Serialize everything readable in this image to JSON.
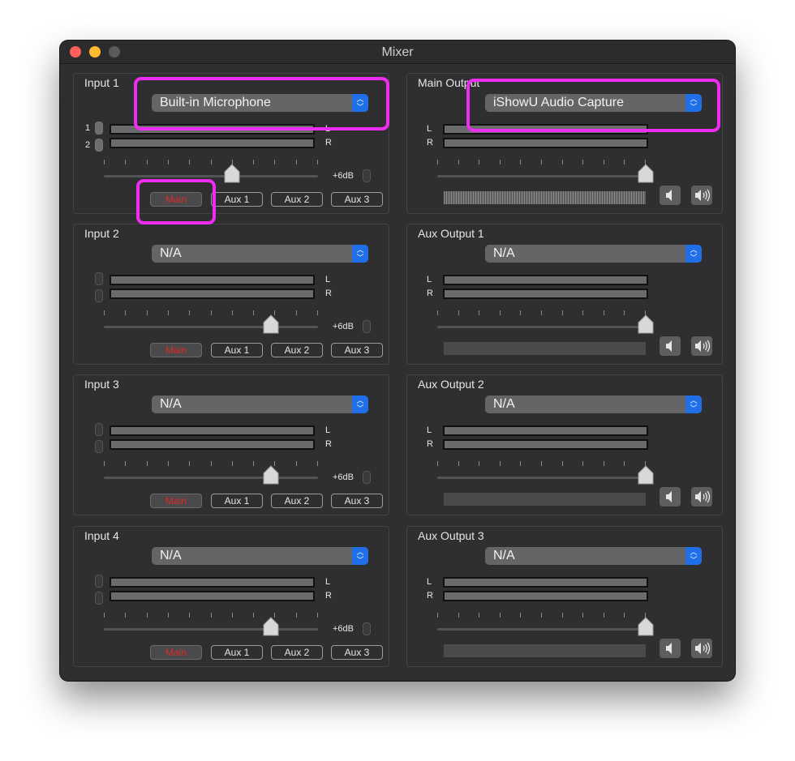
{
  "window": {
    "title": "Mixer"
  },
  "inputs": [
    {
      "title": "Input 1",
      "device": "Built-in Microphone",
      "channels": [
        "1",
        "2"
      ],
      "gain": "+6dB",
      "main_active": true,
      "buses": {
        "main": "Main",
        "aux1": "Aux 1",
        "aux2": "Aux 2",
        "aux3": "Aux 3"
      }
    },
    {
      "title": "Input 2",
      "device": "N/A",
      "gain": "+6dB",
      "buses": {
        "main": "Main",
        "aux1": "Aux 1",
        "aux2": "Aux 2",
        "aux3": "Aux 3"
      }
    },
    {
      "title": "Input 3",
      "device": "N/A",
      "gain": "+6dB",
      "buses": {
        "main": "Main",
        "aux1": "Aux 1",
        "aux2": "Aux 2",
        "aux3": "Aux 3"
      }
    },
    {
      "title": "Input 4",
      "device": "N/A",
      "gain": "+6dB",
      "buses": {
        "main": "Main",
        "aux1": "Aux 1",
        "aux2": "Aux 2",
        "aux3": "Aux 3"
      }
    }
  ],
  "outputs": [
    {
      "title": "Main Output",
      "device": "iShowU Audio Capture",
      "level_active": true
    },
    {
      "title": "Aux Output 1",
      "device": "N/A"
    },
    {
      "title": "Aux Output 2",
      "device": "N/A"
    },
    {
      "title": "Aux Output 3",
      "device": "N/A"
    }
  ],
  "meter_labels": {
    "left": "L",
    "right": "R"
  },
  "input_fader_levels": [
    0.6,
    0.78,
    0.78,
    0.78
  ],
  "output_fader_levels": [
    1.0,
    1.0,
    1.0,
    1.0
  ],
  "icons": {
    "dropdown": "chevron-up-down-icon",
    "stepper": "stepper-icon",
    "fader": "slider-knob-icon",
    "mute_low": "speaker-low-icon",
    "mute_high": "speaker-high-icon"
  },
  "colors": {
    "highlight": "#ee2cf2",
    "accent": "#1f6fe8",
    "main_active_text": "#e02828",
    "panel_bg": "#2f2f31"
  }
}
